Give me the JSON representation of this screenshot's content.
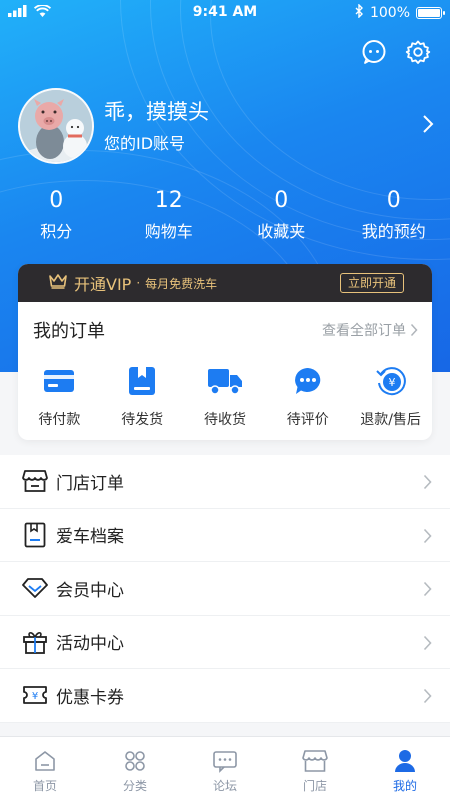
{
  "status_bar": {
    "time": "9:41 AM",
    "battery": "100%",
    "battery_level": 1.0
  },
  "header": {
    "chat_icon": "chat-bubble-icon",
    "settings_icon": "gear-icon"
  },
  "profile": {
    "name": "乖，摸摸头",
    "id_text": "您的ID账号"
  },
  "stats": [
    {
      "value": "0",
      "label": "积分"
    },
    {
      "value": "12",
      "label": "购物车"
    },
    {
      "value": "0",
      "label": "收藏夹"
    },
    {
      "value": "0",
      "label": "我的预约"
    }
  ],
  "vip": {
    "title": "开通VIP",
    "subtitle": "每月免费洗车",
    "button": "立即开通"
  },
  "orders": {
    "title": "我的订单",
    "view_all": "查看全部订单",
    "items": [
      {
        "label": "待付款",
        "icon": "card-icon"
      },
      {
        "label": "待发货",
        "icon": "package-icon"
      },
      {
        "label": "待收货",
        "icon": "truck-icon"
      },
      {
        "label": "待评价",
        "icon": "comment-icon"
      },
      {
        "label": "退款/售后",
        "icon": "refund-icon"
      }
    ]
  },
  "menu": [
    {
      "label": "门店订单",
      "icon": "store-icon"
    },
    {
      "label": "爱车档案",
      "icon": "file-icon"
    },
    {
      "label": "会员中心",
      "icon": "diamond-icon"
    },
    {
      "label": "活动中心",
      "icon": "gift-icon"
    },
    {
      "label": "优惠卡券",
      "icon": "coupon-icon"
    }
  ],
  "tabs": [
    {
      "label": "首页",
      "icon": "home-icon"
    },
    {
      "label": "分类",
      "icon": "grid-icon"
    },
    {
      "label": "论坛",
      "icon": "forum-icon"
    },
    {
      "label": "门店",
      "icon": "store-icon"
    },
    {
      "label": "我的",
      "icon": "user-icon"
    }
  ],
  "colors": {
    "primary": "#1d6ae5",
    "vip_gold": "#e8c27b",
    "vip_bg": "#2d2b2e"
  }
}
